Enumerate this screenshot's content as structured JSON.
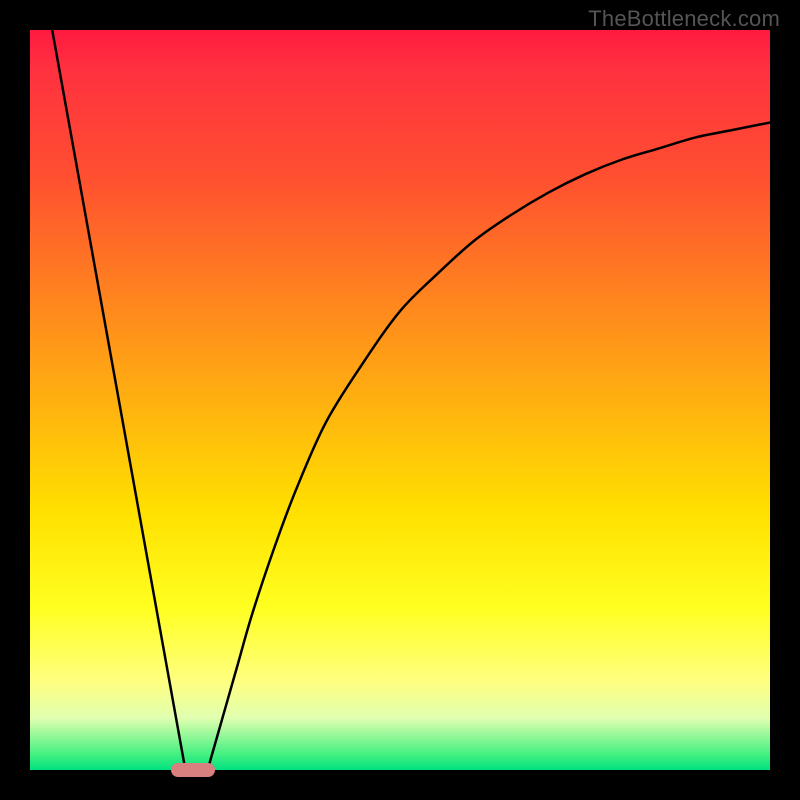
{
  "watermark": "TheBottleneck.com",
  "colors": {
    "frame": "#000000",
    "gradient_top": "#ff1a40",
    "gradient_mid": "#ffe000",
    "gradient_bottom": "#00e080",
    "curve": "#000000",
    "marker": "#d88080"
  },
  "chart_data": {
    "type": "line",
    "title": "",
    "xlabel": "",
    "ylabel": "",
    "xlim": [
      0,
      100
    ],
    "ylim": [
      0,
      100
    ],
    "left_line": {
      "x": [
        3,
        21
      ],
      "y": [
        100,
        0
      ]
    },
    "right_curve": {
      "x": [
        24,
        26,
        28,
        30,
        33,
        36,
        40,
        45,
        50,
        55,
        60,
        65,
        70,
        75,
        80,
        85,
        90,
        95,
        100
      ],
      "y": [
        0,
        7,
        14,
        21,
        30,
        38,
        47,
        55,
        62,
        67,
        71.5,
        75,
        78,
        80.5,
        82.5,
        84,
        85.5,
        86.5,
        87.5
      ]
    },
    "marker": {
      "x_center": 22,
      "y": 0,
      "width": 6,
      "height": 2
    }
  }
}
